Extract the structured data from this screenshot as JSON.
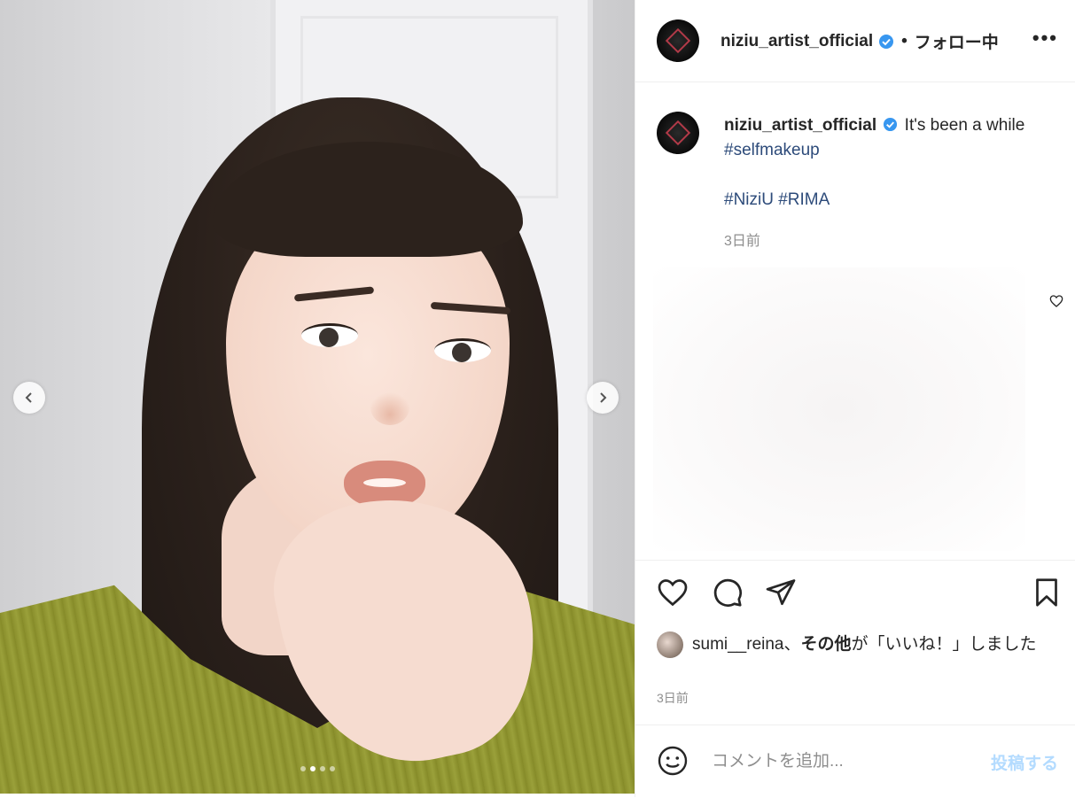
{
  "header": {
    "username": "niziu_artist_official",
    "separator": "•",
    "follow_label": "フォロー中",
    "more_label": "•••"
  },
  "caption": {
    "username": "niziu_artist_official",
    "text": "It's been a while",
    "tag_selfmakeup": "#selfmakeup",
    "tag_niziu": "#NiziU",
    "tag_rima": "#RIMA",
    "time": "3日前"
  },
  "likes": {
    "user": "sumi__reina",
    "separator": "、",
    "others": "その他",
    "suffix": "が「いいね！」しました",
    "time": "3日前"
  },
  "comment": {
    "placeholder": "コメントを追加...",
    "post_label": "投稿する"
  },
  "carousel": {
    "slide_count": 4,
    "active_slide": 2
  },
  "colors": {
    "verified": "#3897f0",
    "hashtag": "#2d4b7a",
    "post_button_disabled": "#b3dbff"
  }
}
